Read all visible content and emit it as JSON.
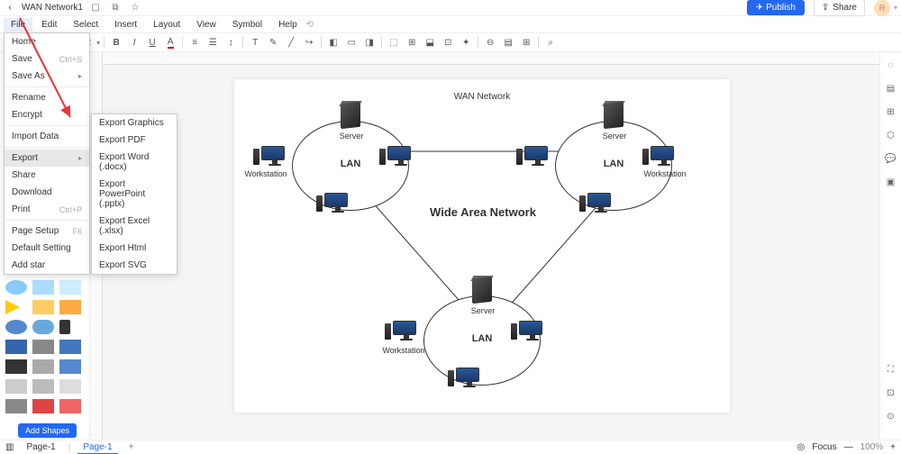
{
  "titlebar": {
    "doc_title": "WAN Network1",
    "publish": "Publish",
    "share": "Share",
    "avatar": "R"
  },
  "menubar": [
    "File",
    "Edit",
    "Select",
    "Insert",
    "Layout",
    "View",
    "Symbol",
    "Help"
  ],
  "toolbar": {
    "fontsize": "12"
  },
  "file_menu": {
    "items": [
      {
        "label": "Home",
        "sep": false
      },
      {
        "label": "Save",
        "shortcut": "Ctrl+S",
        "sep": false
      },
      {
        "label": "Save As",
        "arrow": true,
        "sep": true
      },
      {
        "label": "Rename",
        "sep": false
      },
      {
        "label": "Encrypt",
        "sep": true
      },
      {
        "label": "Import Data",
        "sep": true
      },
      {
        "label": "Export",
        "arrow": true,
        "active": true,
        "sep": false
      },
      {
        "label": "Share",
        "sep": false
      },
      {
        "label": "Download",
        "sep": false
      },
      {
        "label": "Print",
        "shortcut": "Ctrl+P",
        "sep": true
      },
      {
        "label": "Page Setup",
        "shortcut": "F6",
        "sep": false
      },
      {
        "label": "Default Setting",
        "sep": false
      },
      {
        "label": "Add star",
        "sep": false
      }
    ]
  },
  "export_menu": {
    "items": [
      "Export Graphics",
      "Export PDF",
      "Export Word (.docx)",
      "Export PowerPoint (.pptx)",
      "Export Excel (.xlsx)",
      "Export Html",
      "Export SVG"
    ]
  },
  "diagram": {
    "title": "WAN Network",
    "center": "Wide Area Network",
    "lan": "LAN",
    "server": "Server",
    "workstation": "Workstation"
  },
  "bottombar": {
    "tab": "Page-1",
    "tab2": "Page-1",
    "focus": "Focus",
    "zoom": "100%"
  },
  "leftpanel": {
    "add_shapes": "Add Shapes"
  }
}
